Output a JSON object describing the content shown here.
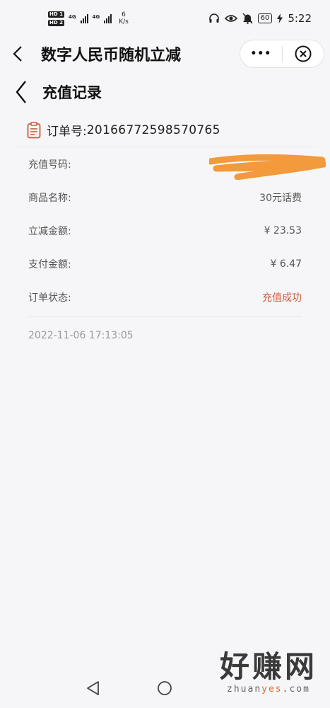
{
  "status_bar": {
    "hd1": "HD 1",
    "hd2": "HD 2",
    "net1": "4G",
    "net2": "4G",
    "speed_value": "6",
    "speed_unit": "K/s",
    "battery": "60",
    "time": "5:22"
  },
  "app_header": {
    "title": "数字人民币随机立减",
    "more_glyph": "•••"
  },
  "page": {
    "title": "充值记录"
  },
  "order": {
    "label": "订单号:",
    "number": "20166772598570765"
  },
  "details": [
    {
      "label": "充值号码:",
      "value": ""
    },
    {
      "label": "商品名称:",
      "value": "30元话费"
    },
    {
      "label": "立减金额:",
      "value": "¥ 23.53"
    },
    {
      "label": "支付金额:",
      "value": "¥ 6.47"
    },
    {
      "label": "订单状态:",
      "value": "充值成功"
    }
  ],
  "timestamp": "2022-11-06 17:13:05",
  "watermark": {
    "main": "好赚网",
    "sub_prefix": "zhuan",
    "sub_accent": "yes",
    "sub_suffix": ".com"
  },
  "colors": {
    "success": "#d0583c",
    "order_icon": "#d0583c",
    "redaction": "#f39a3c"
  }
}
